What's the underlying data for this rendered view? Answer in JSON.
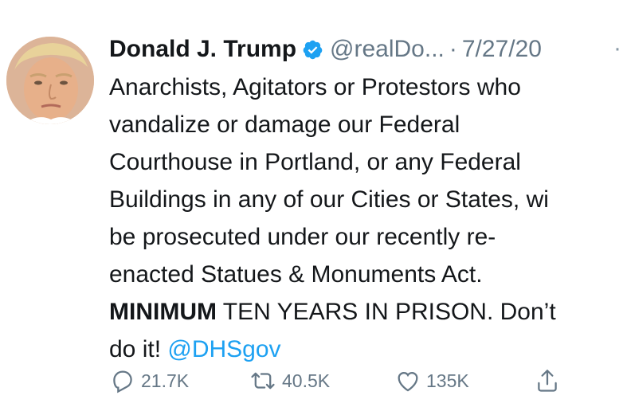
{
  "author": {
    "name": "Donald J. Trump",
    "handle": "@realDo...",
    "date": "7/27/20",
    "separator": "·",
    "more": "·",
    "avatar": "avatar-photo",
    "verified_icon": "verified-badge-icon"
  },
  "tweet": {
    "lines": [
      "Anarchists, Agitators or Protestors who",
      "vandalize or damage our Federal",
      "Courthouse in Portland, or any Federal",
      "Buildings in any of our Cities or States, wi",
      "be prosecuted under our recently re-",
      "enacted Statues & Monuments Act."
    ],
    "line7_bold": "MINIMUM",
    "line7_rest": " TEN YEARS IN PRISON. Don’t",
    "line8_text": "do it! ",
    "mention": "@DHSgov"
  },
  "actions": {
    "reply": {
      "icon": "reply-icon",
      "count": "21.7K"
    },
    "retweet": {
      "icon": "retweet-icon",
      "count": "40.5K"
    },
    "like": {
      "icon": "heart-icon",
      "count": "135K"
    },
    "share": {
      "icon": "share-icon"
    }
  },
  "colors": {
    "text": "#14171a",
    "secondary": "#657786",
    "link": "#1da1f2",
    "verified": "#1da1f2"
  }
}
